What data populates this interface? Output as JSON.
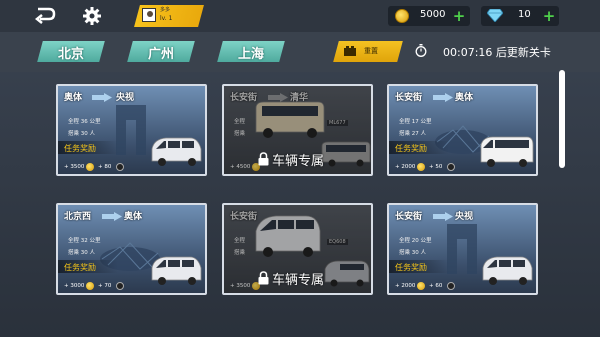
{
  "topbar": {
    "back_icon": "back-arrow-icon",
    "settings_icon": "gear-icon",
    "player": {
      "name": "多多",
      "level": "lv. 1"
    },
    "gold": {
      "icon": "coin-icon",
      "value": "5000",
      "add": "+"
    },
    "gems": {
      "icon": "diamond-icon",
      "value": "10",
      "add": "+"
    }
  },
  "cities": [
    {
      "label": "北京"
    },
    {
      "label": "广州"
    },
    {
      "label": "上海"
    }
  ],
  "reset": {
    "label": "重置",
    "icon": "reset-icon"
  },
  "timer": {
    "icon": "stopwatch-icon",
    "text": "00:07:16 后更新关卡"
  },
  "reward_label": "任务奖励",
  "lock_text": "车辆专属",
  "cards": [
    {
      "from": "奥体",
      "to": "央视",
      "distance": "全程 36 公里",
      "passengers": "搭乘 30 人",
      "coins": "+ 3500",
      "xp": "+ 80",
      "locked": false
    },
    {
      "from": "长安街",
      "to": "清华",
      "distance": "全程",
      "passengers": "搭乘",
      "coins": "+ 4500",
      "xp": "",
      "id": "ML677",
      "locked": true
    },
    {
      "from": "长安街",
      "to": "奥体",
      "distance": "全程 17 公里",
      "passengers": "搭乘 27 人",
      "coins": "+ 2000",
      "xp": "+ 50",
      "locked": false
    },
    {
      "from": "北京西",
      "to": "奥体",
      "distance": "全程 32 公里",
      "passengers": "搭乘 30 人",
      "coins": "+ 3000",
      "xp": "+ 70",
      "locked": false
    },
    {
      "from": "长安街",
      "to": "",
      "distance": "全程",
      "passengers": "搭乘",
      "coins": "+ 3500",
      "xp": "",
      "id": "EQ608",
      "locked": true
    },
    {
      "from": "长安街",
      "to": "央视",
      "distance": "全程 20 公里",
      "passengers": "搭乘 30 人",
      "coins": "+ 2000",
      "xp": "+ 60",
      "locked": false
    }
  ],
  "colors": {
    "accent_gold": "#f5c518",
    "tab_teal": "#5fb8ab",
    "plus_green": "#4fd04b"
  }
}
